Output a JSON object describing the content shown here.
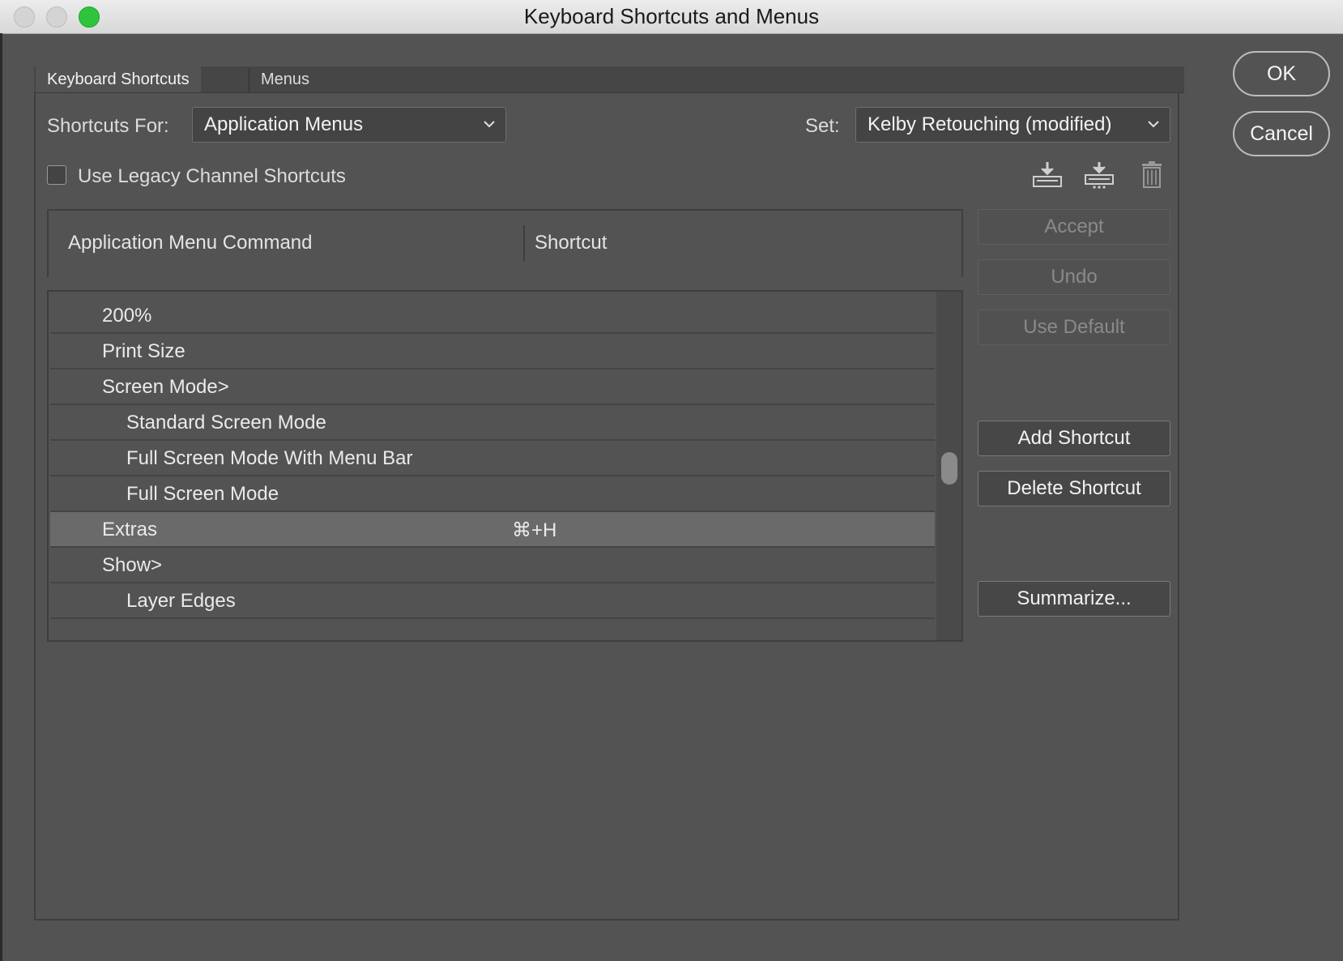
{
  "window": {
    "title": "Keyboard Shortcuts and Menus"
  },
  "tabs": [
    {
      "label": "Keyboard Shortcuts",
      "active": true
    },
    {
      "label": "Menus",
      "active": false
    }
  ],
  "shortcuts_for": {
    "label": "Shortcuts For:",
    "value": "Application Menus"
  },
  "set": {
    "label": "Set:",
    "value": "Kelby Retouching (modified)"
  },
  "legacy": {
    "label": "Use Legacy Channel Shortcuts",
    "checked": false
  },
  "toolbar_icons": [
    "save-set-icon",
    "save-set-as-icon",
    "delete-set-icon"
  ],
  "table": {
    "columns": [
      "Application Menu Command",
      "Shortcut"
    ],
    "rows": [
      {
        "command": "200%",
        "shortcut": "",
        "indent": 1
      },
      {
        "command": "Print Size",
        "shortcut": "",
        "indent": 1
      },
      {
        "command": "Screen Mode>",
        "shortcut": "",
        "indent": 1
      },
      {
        "command": "Standard Screen Mode",
        "shortcut": "",
        "indent": 2
      },
      {
        "command": "Full Screen Mode With Menu Bar",
        "shortcut": "",
        "indent": 2
      },
      {
        "command": "Full Screen Mode",
        "shortcut": "",
        "indent": 2
      },
      {
        "command": "Extras",
        "shortcut": "⌘+H",
        "indent": 1,
        "selected": true
      },
      {
        "command": "Show>",
        "shortcut": "",
        "indent": 1
      },
      {
        "command": "Layer Edges",
        "shortcut": "",
        "indent": 2
      }
    ]
  },
  "side_buttons": {
    "accept": "Accept",
    "undo": "Undo",
    "use_default": "Use Default",
    "add_shortcut": "Add Shortcut",
    "delete_shortcut": "Delete Shortcut",
    "summarize": "Summarize..."
  },
  "dialog_buttons": {
    "ok": "OK",
    "cancel": "Cancel"
  },
  "colors": {
    "background": "#535353",
    "selected_row": "#6a6a6a",
    "zoom_button": "#2fc43d"
  }
}
